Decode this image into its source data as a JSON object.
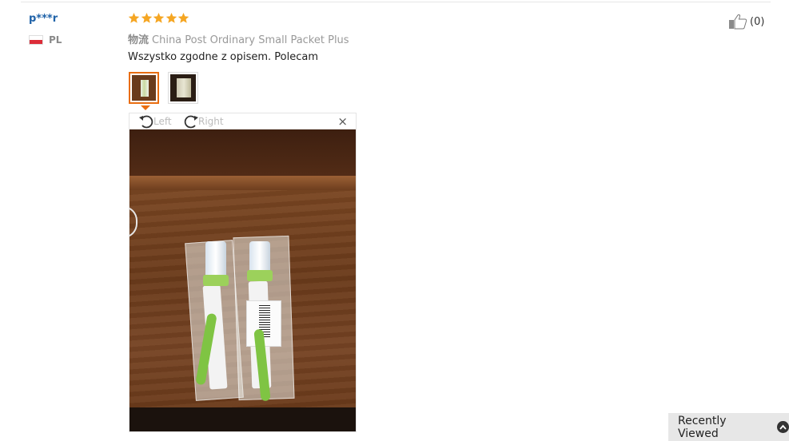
{
  "review": {
    "user_name": "p***r",
    "country_code": "PL",
    "rating": 5,
    "logistics_label": "物流",
    "logistics_value": "China Post Ordinary Small Packet Plus",
    "text": "Wszystko zgodne z opisem. Polecam",
    "like_count": "(0)",
    "thumbnails": [
      "photo-1",
      "photo-2"
    ],
    "active_thumbnail": 0
  },
  "viewer": {
    "rotate_left_label": "Left",
    "rotate_right_label": "Right",
    "close_label": "×"
  },
  "recently_viewed": {
    "label": "Recently Viewed"
  },
  "colors": {
    "accent": "#e96d10",
    "star": "#f5a623",
    "username": "#1f62a8",
    "muted": "#999999"
  },
  "icons": {
    "star": "star-icon",
    "flag": "flag-poland-icon",
    "like": "thumbs-up-icon",
    "rotate_left": "rotate-left-icon",
    "rotate_right": "rotate-right-icon",
    "close": "close-icon",
    "chevron_up": "chevron-up-icon"
  }
}
